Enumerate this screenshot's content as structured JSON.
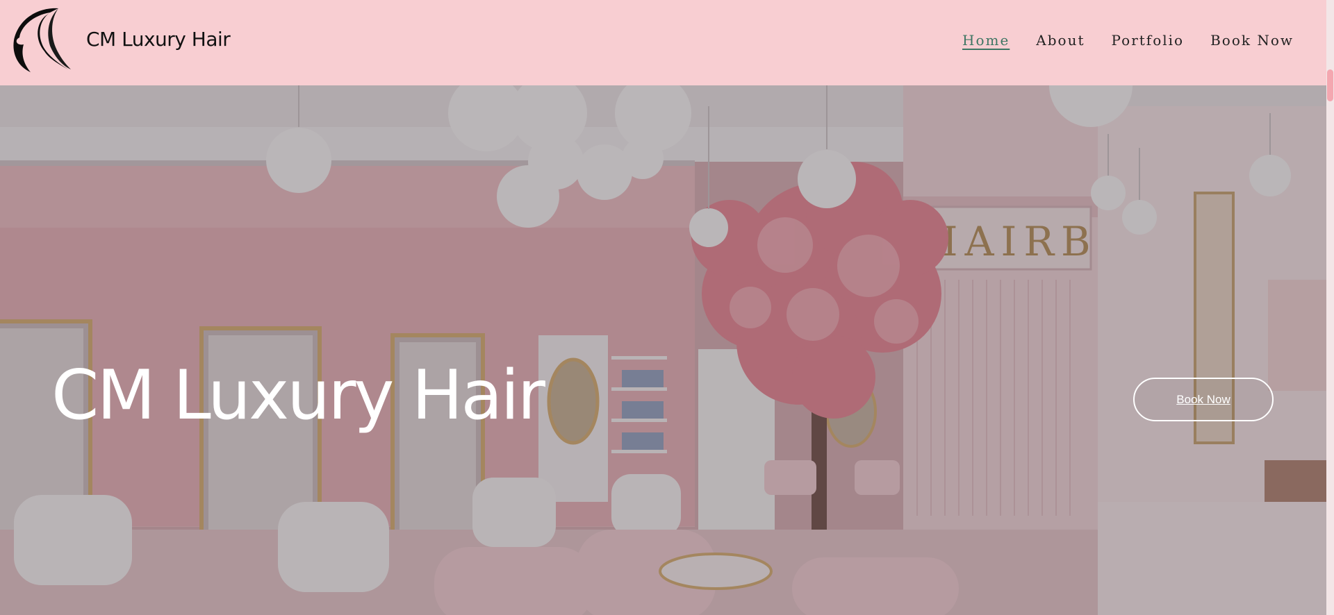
{
  "header": {
    "brand": "CM Luxury Hair",
    "logo_icon": "woman-profile-silhouette-icon",
    "nav": [
      {
        "label": "Home",
        "active": true
      },
      {
        "label": "About",
        "active": false
      },
      {
        "label": "Portfolio",
        "active": false
      },
      {
        "label": "Book Now",
        "active": false
      }
    ]
  },
  "hero": {
    "title": "CM Luxury Hair",
    "button_label": "Book Now",
    "sign_text": "HAIRB"
  },
  "colors": {
    "header_bg": "#f8ced2",
    "active_nav": "#3e7563",
    "text": "#111111",
    "hero_text": "#ffffff"
  }
}
